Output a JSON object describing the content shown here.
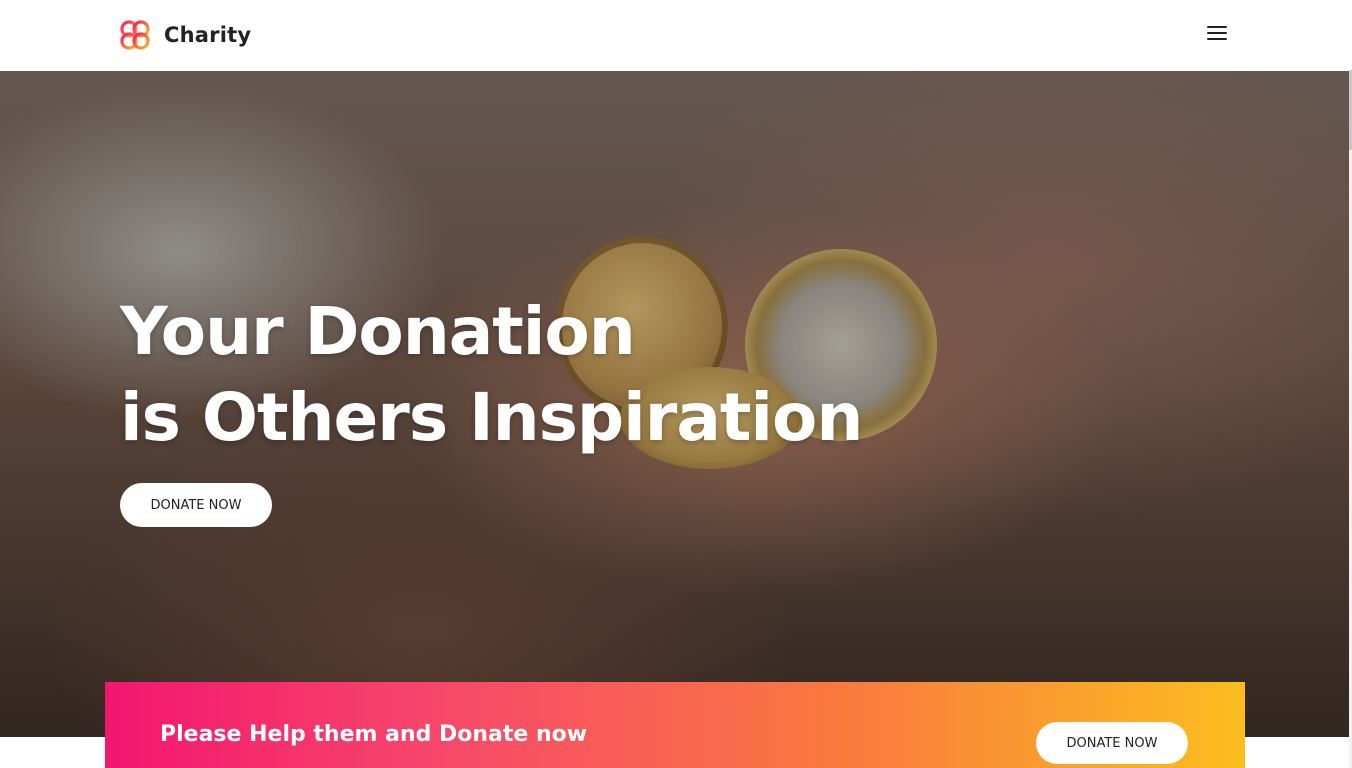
{
  "header": {
    "brand": "Charity",
    "logo_colors": [
      "#f3166f",
      "#fa7a3e",
      "#fbbe1e"
    ],
    "menu_icon": "hamburger-menu-icon"
  },
  "hero": {
    "title_line1": "Your Donation",
    "title_line2": "is Others Inspiration",
    "button_label": "DONATE NOW"
  },
  "cta": {
    "text": "Please Help them and Donate now",
    "button_label": "DONATE NOW",
    "gradient": [
      "#f3166f",
      "#fa7a3e",
      "#fbbe1e"
    ]
  }
}
